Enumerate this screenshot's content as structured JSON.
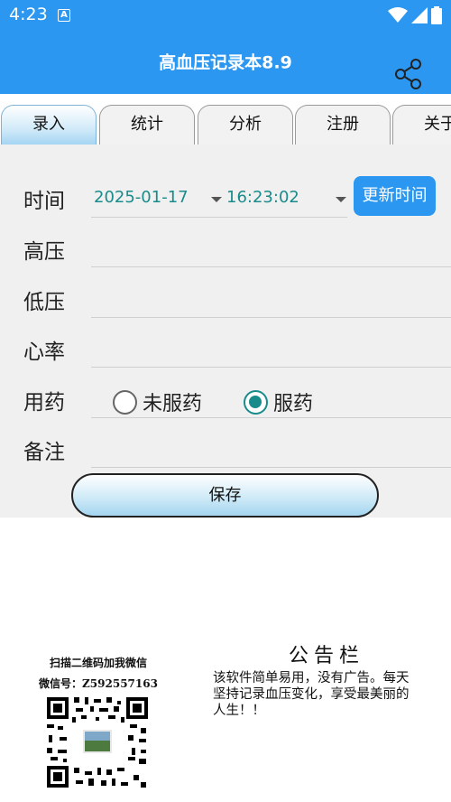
{
  "status_bar": {
    "time": "4:23",
    "notification_badge": "A",
    "icons": [
      "wifi-icon",
      "signal-icon",
      "battery-icon"
    ]
  },
  "app_bar": {
    "title": "高血压记录本8.9",
    "share_icon": "share-icon"
  },
  "tabs": [
    {
      "label": "录入",
      "active": true
    },
    {
      "label": "统计",
      "active": false
    },
    {
      "label": "分析",
      "active": false
    },
    {
      "label": "注册",
      "active": false
    },
    {
      "label": "关于",
      "active": false
    }
  ],
  "form": {
    "time_label": "时间",
    "date_value": "2025-01-17",
    "time_value": "16:23:02",
    "update_time_button": "更新时间",
    "systolic_label": "高压",
    "systolic_value": "",
    "diastolic_label": "低压",
    "diastolic_value": "",
    "heart_rate_label": "心率",
    "heart_rate_value": "",
    "medication_label": "用药",
    "medication_options": [
      {
        "label": "未服药",
        "checked": false
      },
      {
        "label": "服药",
        "checked": true
      }
    ],
    "note_label": "备注",
    "note_value": "",
    "save_button": "保存"
  },
  "qr": {
    "caption": "扫描二维码加我微信",
    "wechat_id": "微信号：Z592557163"
  },
  "notice": {
    "title": "公告栏",
    "text": "该软件简单易用，没有广告。每天坚持记录血压变化，享受最美丽的人生！！"
  },
  "colors": {
    "primary": "#2b97f0",
    "accent": "#1a8b8b",
    "form_bg": "#f0f0f0"
  }
}
